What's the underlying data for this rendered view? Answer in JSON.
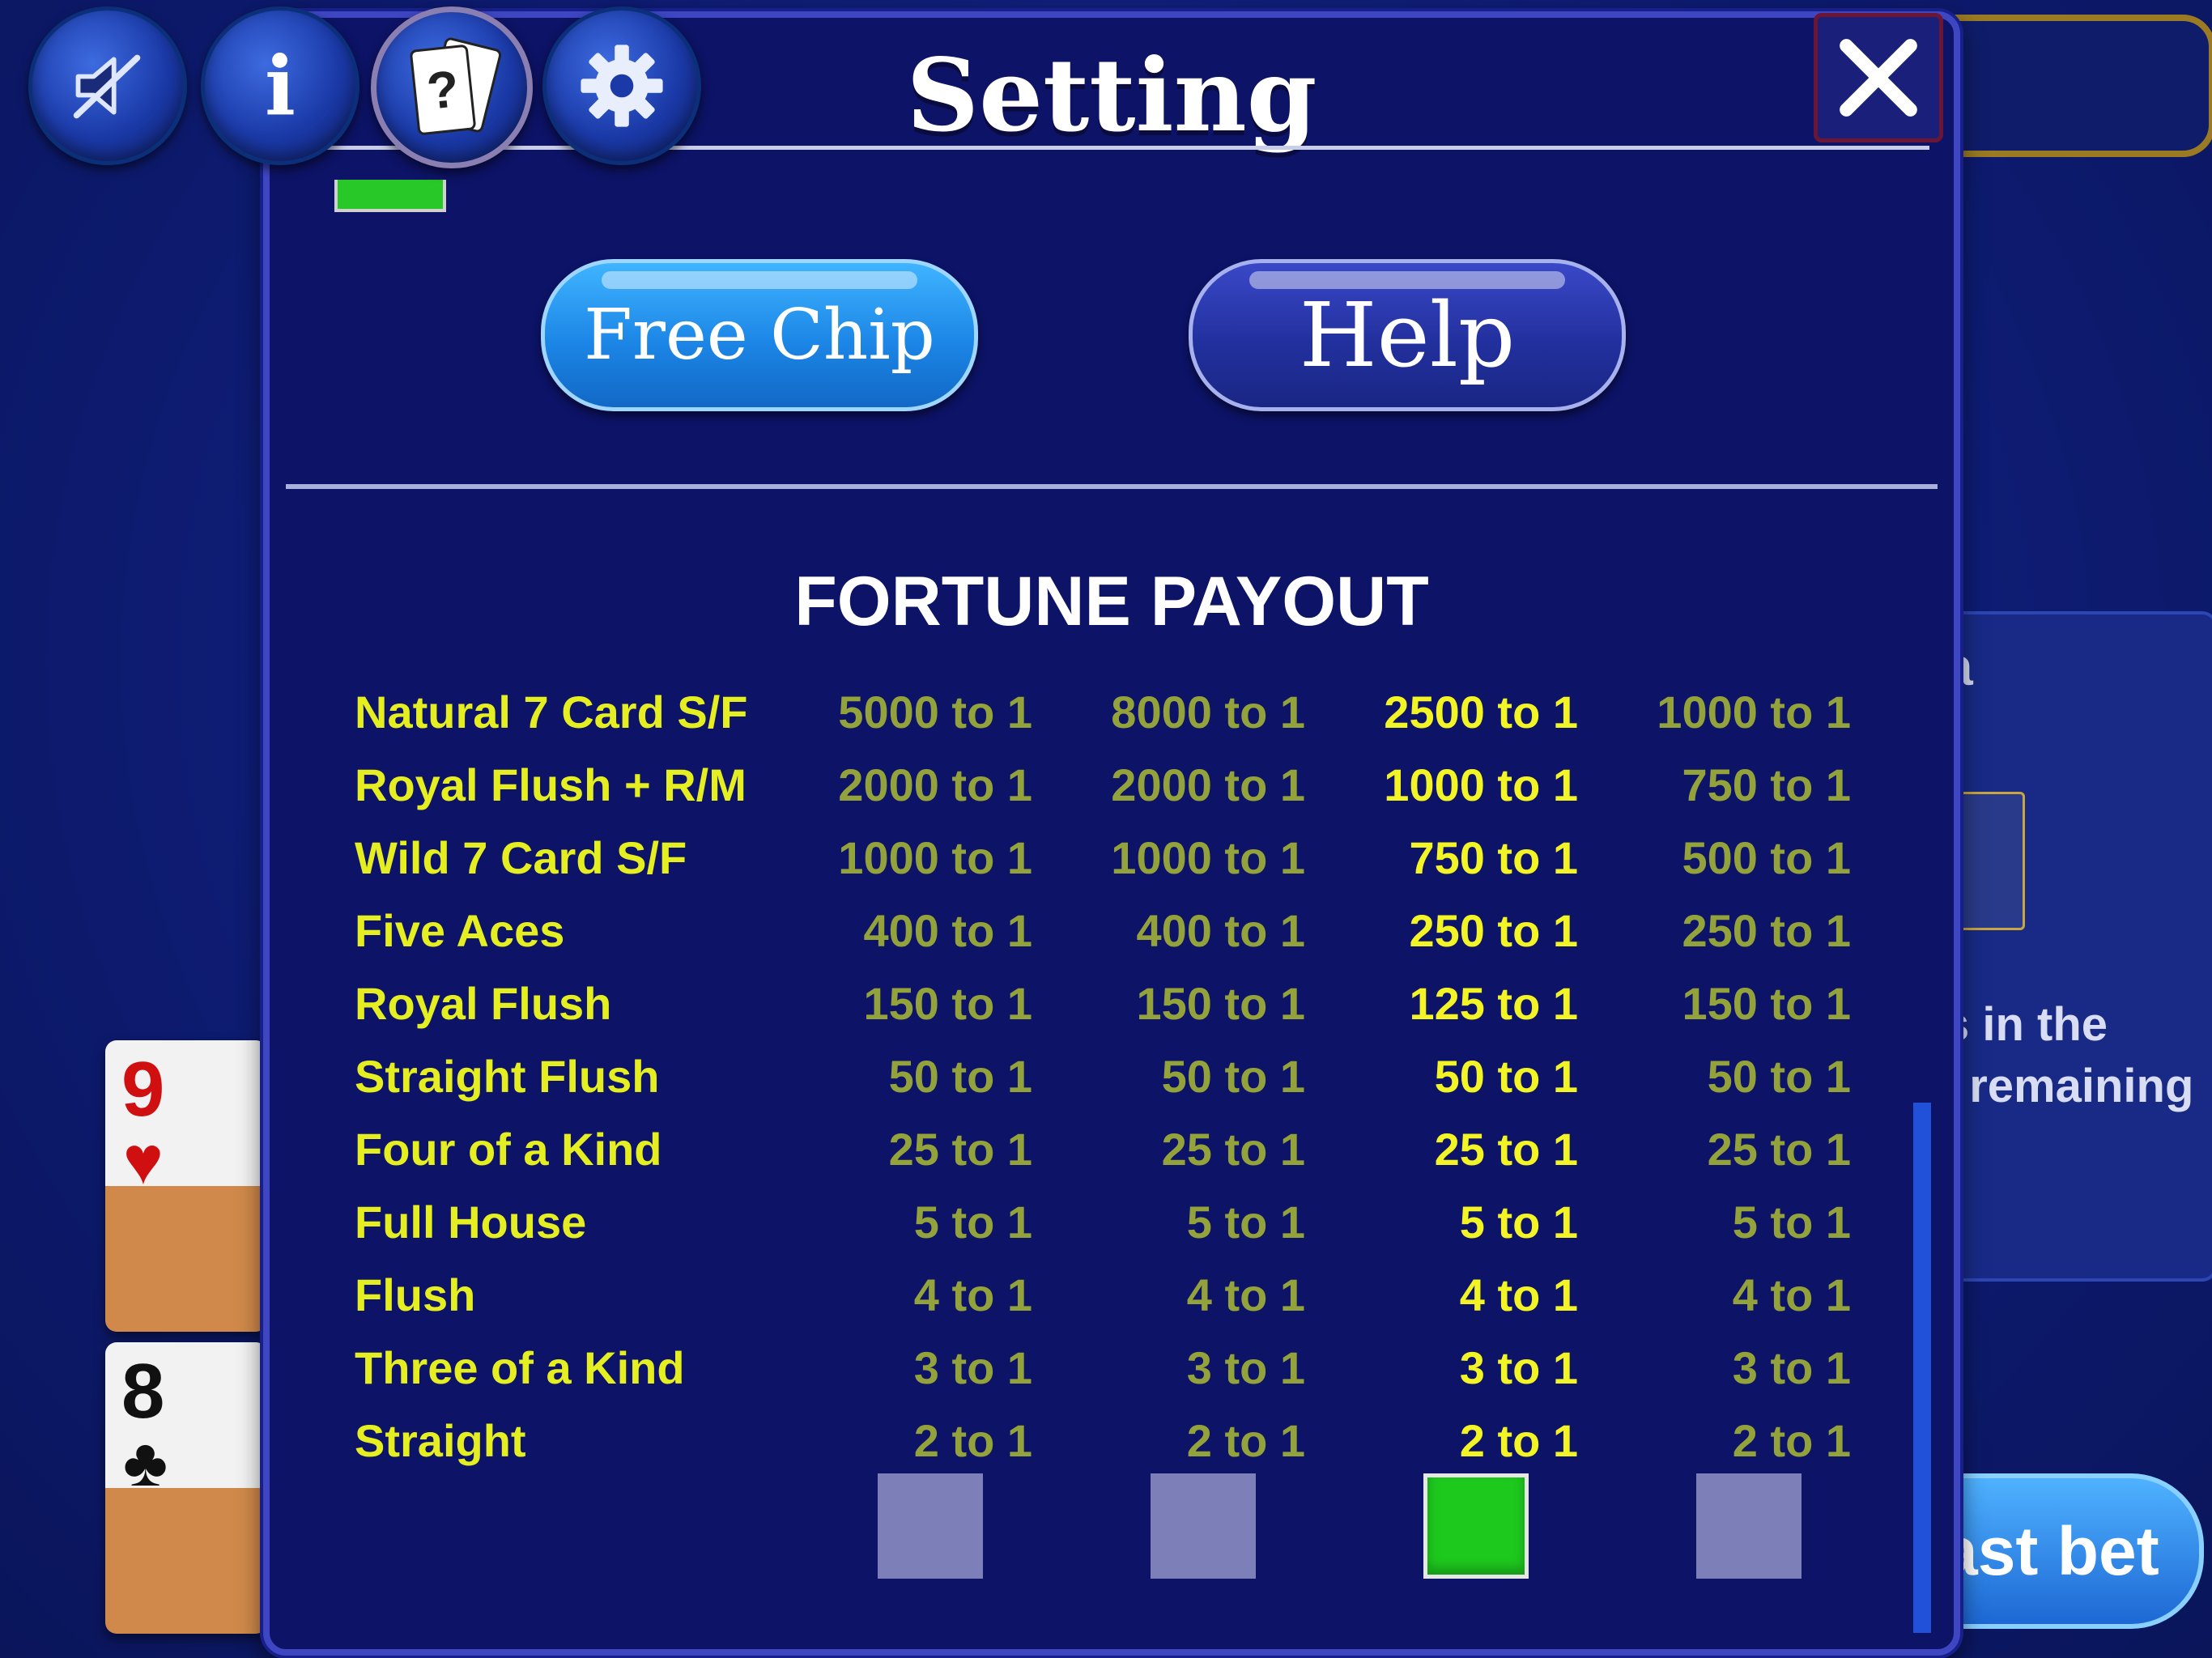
{
  "header": {
    "title": "Setting"
  },
  "toolbar": {
    "buttons": [
      {
        "name": "mute-button",
        "icon": "speaker-muted-icon"
      },
      {
        "name": "info-button",
        "icon": "info-icon",
        "glyph": "i"
      },
      {
        "name": "cards-help-button",
        "icon": "question-cards-icon",
        "glyph": "?"
      },
      {
        "name": "settings-button",
        "icon": "gear-icon"
      }
    ]
  },
  "actions": {
    "free_chip_label": "Free Chip",
    "help_label": "Help"
  },
  "payout": {
    "title": "FORTUNE PAYOUT",
    "selected_column": 3,
    "rows": [
      {
        "hand": "Natural 7 Card S/F",
        "v1": "5000 to 1",
        "v2": "8000 to 1",
        "v3": "2500 to 1",
        "v4": "1000 to 1"
      },
      {
        "hand": "Royal Flush + R/M",
        "v1": "2000 to 1",
        "v2": "2000 to 1",
        "v3": "1000 to 1",
        "v4": "750 to 1"
      },
      {
        "hand": "Wild 7 Card S/F",
        "v1": "1000 to 1",
        "v2": "1000 to 1",
        "v3": "750 to 1",
        "v4": "500 to 1"
      },
      {
        "hand": "Five Aces",
        "v1": "400 to 1",
        "v2": "400 to 1",
        "v3": "250 to 1",
        "v4": "250 to 1"
      },
      {
        "hand": "Royal Flush",
        "v1": "150 to 1",
        "v2": "150 to 1",
        "v3": "125 to 1",
        "v4": "150 to 1"
      },
      {
        "hand": "Straight Flush",
        "v1": "50 to 1",
        "v2": "50 to 1",
        "v3": "50 to 1",
        "v4": "50 to 1"
      },
      {
        "hand": "Four of a Kind",
        "v1": "25 to 1",
        "v2": "25 to 1",
        "v3": "25 to 1",
        "v4": "25 to 1"
      },
      {
        "hand": "Full House",
        "v1": "5 to 1",
        "v2": "5 to 1",
        "v3": "5 to 1",
        "v4": "5 to 1"
      },
      {
        "hand": "Flush",
        "v1": "4 to 1",
        "v2": "4 to 1",
        "v3": "4 to 1",
        "v4": "4 to 1"
      },
      {
        "hand": "Three of a Kind",
        "v1": "3 to 1",
        "v2": "3 to 1",
        "v3": "3 to 1",
        "v4": "3 to 1"
      },
      {
        "hand": "Straight",
        "v1": "2 to 1",
        "v2": "2 to 1",
        "v3": "2 to 1",
        "v4": "2 to 1"
      }
    ]
  },
  "background": {
    "card1_rank": "9",
    "card1_suit": "♥",
    "card2_rank": "8",
    "card2_suit": "♣",
    "panel_partial_text_1": "a",
    "panel_partial_text_2": "s in the",
    "panel_partial_text_3": "l remaining",
    "button_partial_label": "ast bet"
  },
  "colors": {
    "dialog_bg": "#0d1366",
    "hand_label": "#e4ee21",
    "value_dim": "#93a23b",
    "value_selected": "#f2f425",
    "checkbox_on": "#1ec91e",
    "checkbox_off": "#7c7fb8"
  }
}
